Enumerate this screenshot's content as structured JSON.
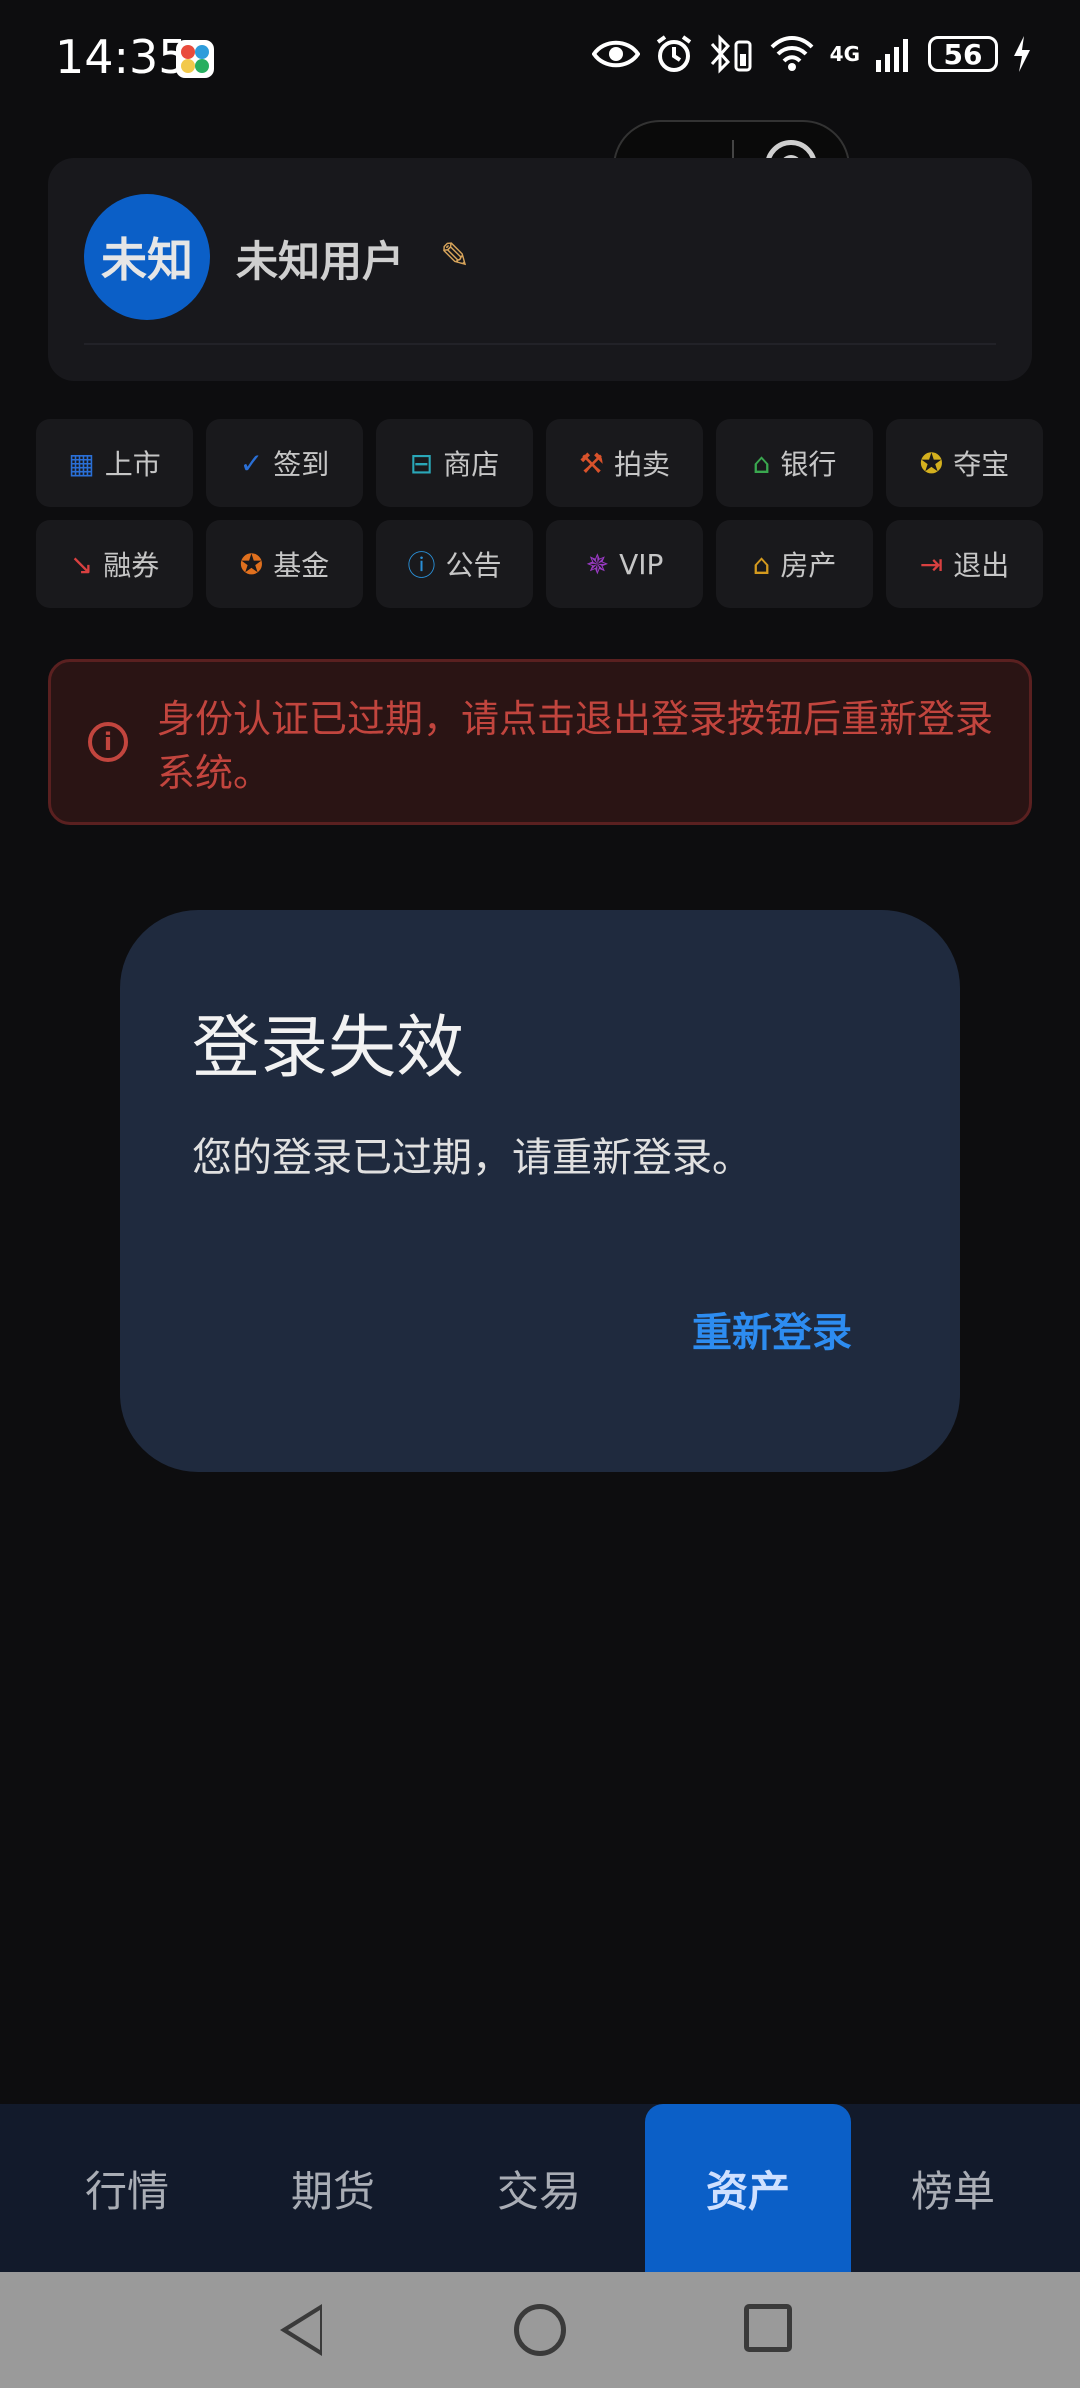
{
  "status_bar": {
    "time": "14:35",
    "network": "4G",
    "battery": "56"
  },
  "profile": {
    "avatar_text": "未知",
    "username": "未知用户"
  },
  "grid_buttons": [
    {
      "label": "上市",
      "icon": "building-icon",
      "glyph": "▦",
      "color": "#2a6fd6"
    },
    {
      "label": "签到",
      "icon": "check-circle-icon",
      "glyph": "✓",
      "color": "#2a6fd6"
    },
    {
      "label": "商店",
      "icon": "store-icon",
      "glyph": "⊟",
      "color": "#2aa7b8"
    },
    {
      "label": "拍卖",
      "icon": "gavel-icon",
      "glyph": "⚒",
      "color": "#d8522b"
    },
    {
      "label": "银行",
      "icon": "bank-icon",
      "glyph": "⌂",
      "color": "#3aa84f"
    },
    {
      "label": "夺宝",
      "icon": "star-icon",
      "glyph": "✪",
      "color": "#d4b01e"
    },
    {
      "label": "融券",
      "icon": "trend-down-icon",
      "glyph": "↘",
      "color": "#d84040"
    },
    {
      "label": "基金",
      "icon": "fund-star-icon",
      "glyph": "✪",
      "color": "#e0701e"
    },
    {
      "label": "公告",
      "icon": "info-icon",
      "glyph": "ⓘ",
      "color": "#2a8fd6"
    },
    {
      "label": "VIP",
      "icon": "vip-badge-icon",
      "glyph": "✵",
      "color": "#9a3ac4"
    },
    {
      "label": "房产",
      "icon": "house-icon",
      "glyph": "⌂",
      "color": "#d49a1e"
    },
    {
      "label": "退出",
      "icon": "logout-icon",
      "glyph": "⇥",
      "color": "#d84040"
    }
  ],
  "alert": {
    "text": "身份认证已过期，请点击退出登录按钮后重新登录系统。"
  },
  "dialog": {
    "title": "登录失效",
    "message": "您的登录已过期，请重新登录。",
    "button": "重新登录"
  },
  "bottom_nav": [
    "行情",
    "期货",
    "交易",
    "资产",
    "榜单"
  ],
  "bottom_nav_active": "资产"
}
